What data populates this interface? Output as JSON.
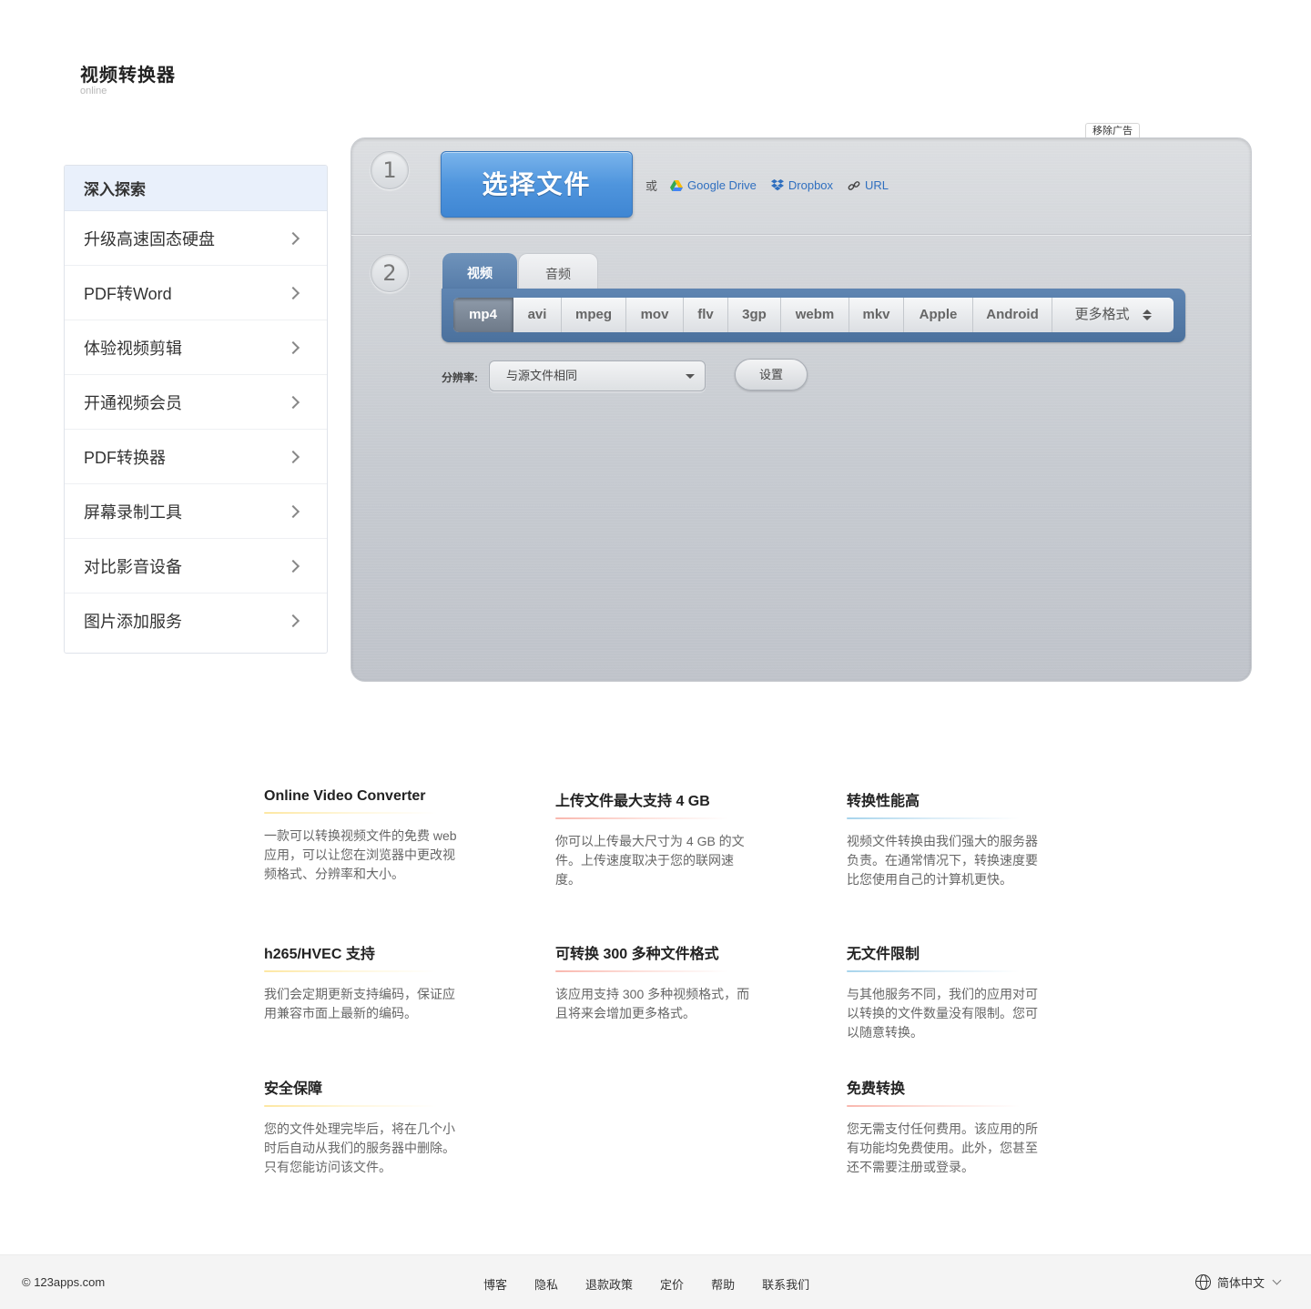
{
  "logo": {
    "title": "视频转换器",
    "subtitle": "online"
  },
  "sidebar": {
    "heading": "深入探索",
    "items": [
      {
        "label": "升级高速固态硬盘"
      },
      {
        "label": "PDF转Word"
      },
      {
        "label": "体验视频剪辑"
      },
      {
        "label": "开通视频会员"
      },
      {
        "label": "PDF转换器"
      },
      {
        "label": "屏幕录制工具"
      },
      {
        "label": "对比影音设备"
      },
      {
        "label": "图片添加服务"
      }
    ]
  },
  "remove_ad": "移除广告",
  "converter": {
    "step1": "1",
    "step2": "2",
    "choose_file": "选择文件",
    "or": "或",
    "sources": {
      "google_drive": "Google Drive",
      "dropbox": "Dropbox",
      "url": "URL"
    },
    "tabs": {
      "video": "视频",
      "audio": "音频"
    },
    "formats": [
      "mp4",
      "avi",
      "mpeg",
      "mov",
      "flv",
      "3gp",
      "webm",
      "mkv",
      "Apple",
      "Android"
    ],
    "active_format": "mp4",
    "more_formats": "更多格式",
    "resolution_label": "分辨率:",
    "resolution_value": "与源文件相同",
    "settings": "设置"
  },
  "features": {
    "f1": {
      "title": "Online Video Converter",
      "text": "一款可以转换视频文件的免费 web 应用，可以让您在浏览器中更改视频格式、分辨率和大小。"
    },
    "f2": {
      "title": "上传文件最大支持 4 GB",
      "text": "你可以上传最大尺寸为 4 GB 的文件。上传速度取决于您的联网速度。"
    },
    "f3": {
      "title": "转换性能高",
      "text": "视频文件转换由我们强大的服务器负责。在通常情况下，转换速度要比您使用自己的计算机更快。"
    },
    "f4": {
      "title": "h265/HVEC 支持",
      "text": "我们会定期更新支持编码，保证应用兼容市面上最新的编码。"
    },
    "f5": {
      "title": "可转换 300 多种文件格式",
      "text": "该应用支持 300 多种视频格式，而且将来会增加更多格式。"
    },
    "f6": {
      "title": "无文件限制",
      "text": "与其他服务不同，我们的应用对可以转换的文件数量没有限制。您可以随意转换。"
    },
    "f7": {
      "title": "安全保障",
      "text": "您的文件处理完毕后，将在几个小时后自动从我们的服务器中删除。只有您能访问该文件。"
    },
    "f8": {
      "title": "免费转换",
      "text": "您无需支付任何费用。该应用的所有功能均免费使用。此外，您甚至还不需要注册或登录。"
    }
  },
  "footer": {
    "copyright": "© 123apps.com",
    "links": [
      "博客",
      "隐私",
      "退款政策",
      "定价",
      "帮助",
      "联系我们"
    ],
    "language": "简体中文"
  }
}
